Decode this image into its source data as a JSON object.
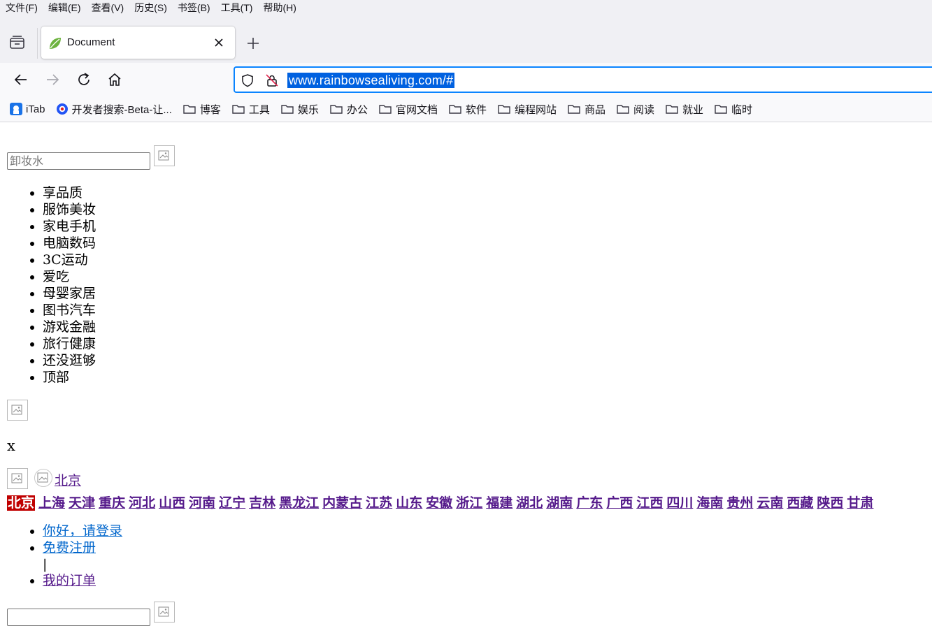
{
  "menu": [
    "文件(F)",
    "编辑(E)",
    "查看(V)",
    "历史(S)",
    "书签(B)",
    "工具(T)",
    "帮助(H)"
  ],
  "tab": {
    "title": "Document"
  },
  "url": "www.rainbowsealiving.com/#",
  "bookmarks": [
    {
      "label": "iTab",
      "type": "app"
    },
    {
      "label": "开发者搜索-Beta-让...",
      "type": "app"
    },
    {
      "label": "博客",
      "type": "folder"
    },
    {
      "label": "工具",
      "type": "folder"
    },
    {
      "label": "娱乐",
      "type": "folder"
    },
    {
      "label": "办公",
      "type": "folder"
    },
    {
      "label": "官网文档",
      "type": "folder"
    },
    {
      "label": "软件",
      "type": "folder"
    },
    {
      "label": "编程网站",
      "type": "folder"
    },
    {
      "label": "商品",
      "type": "folder"
    },
    {
      "label": "阅读",
      "type": "folder"
    },
    {
      "label": "就业",
      "type": "folder"
    },
    {
      "label": "临时",
      "type": "folder"
    }
  ],
  "search": {
    "placeholder": "卸妆水"
  },
  "categories": [
    "享品质",
    "服饰美妆",
    "家电手机",
    "电脑数码",
    "3C运动",
    "爱吃",
    "母婴家居",
    "图书汽车",
    "游戏金融",
    "旅行健康",
    "还没逛够",
    "顶部"
  ],
  "close_text": "x",
  "location": {
    "current": "北京",
    "provinces": [
      "北京",
      "上海",
      "天津",
      "重庆",
      "河北",
      "山西",
      "河南",
      "辽宁",
      "吉林",
      "黑龙江",
      "内蒙古",
      "江苏",
      "山东",
      "安徽",
      "浙江",
      "福建",
      "湖北",
      "湖南",
      "广东",
      "广西",
      "江西",
      "四川",
      "海南",
      "贵州",
      "云南",
      "西藏",
      "陕西",
      "甘肃"
    ]
  },
  "user_links": {
    "login": "你好，请登录",
    "register": "免费注册",
    "separator": "|",
    "orders": "我的订单"
  },
  "colors": {
    "accent": "#0a84ff",
    "url_selection": "#0061e0",
    "visited_link": "#551a8b",
    "link": "#0066cc",
    "active_province_bg": "#c00000"
  }
}
